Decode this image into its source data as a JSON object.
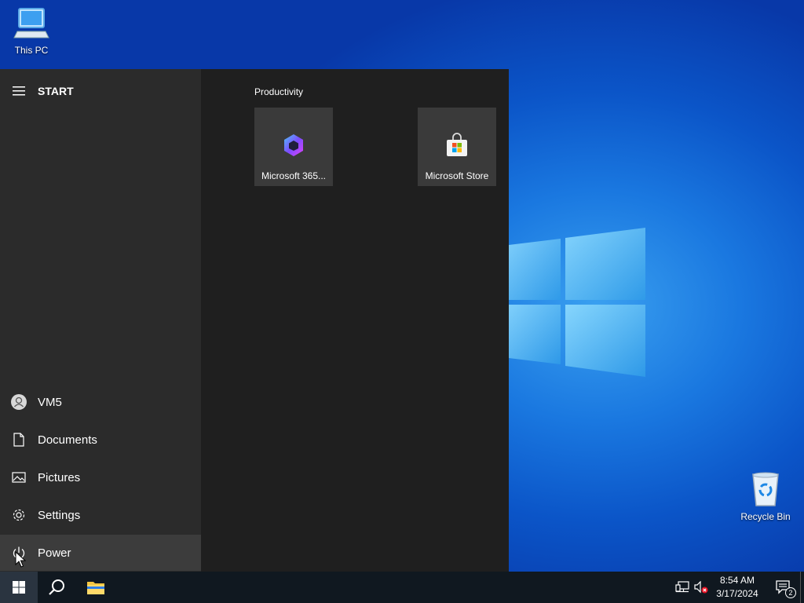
{
  "desktop": {
    "icons": [
      {
        "label": "This PC",
        "icon": "computer-icon"
      },
      {
        "label": "Recycle Bin",
        "icon": "recycle-bin-icon"
      }
    ]
  },
  "start_menu": {
    "header_label": "START",
    "rail": {
      "user": "VM5",
      "documents": "Documents",
      "pictures": "Pictures",
      "settings": "Settings",
      "power": "Power"
    },
    "group_title": "Productivity",
    "tiles": [
      {
        "label": "Microsoft 365...",
        "icon": "microsoft-365-icon"
      },
      {
        "label": "Microsoft Store",
        "icon": "microsoft-store-icon"
      }
    ]
  },
  "taskbar": {
    "clock_time": "8:54 AM",
    "clock_date": "3/17/2024",
    "notification_count": "2"
  },
  "colors": {
    "start_bg": "#1f1f1f",
    "rail_bg": "#2b2b2b",
    "tile_bg": "#3a3a3a",
    "taskbar_bg": "#101820"
  }
}
